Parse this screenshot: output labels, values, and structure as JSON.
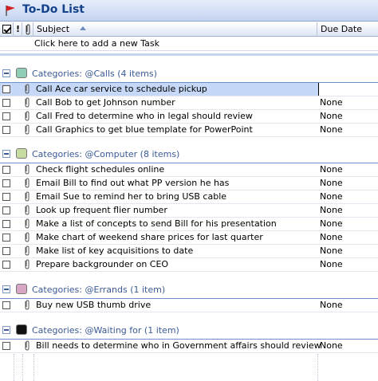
{
  "window": {
    "title": "To-Do List"
  },
  "header": {
    "important_label": "!",
    "subject_label": "Subject",
    "due_label": "Due Date"
  },
  "new_task": {
    "placeholder": "Click here to add a new Task"
  },
  "colors": {
    "calls": "#8fcfb5",
    "computer": "#c6dca0",
    "errands": "#d8a7c3",
    "waiting": "#111111"
  },
  "groups": [
    {
      "label": "Categories: @Calls (4 items)",
      "tasks": [
        {
          "subject": "Call Ace car service to schedule pickup",
          "due": ""
        },
        {
          "subject": "Call Bob to get Johnson number",
          "due": "None"
        },
        {
          "subject": "Call Fred to determine who in legal should review",
          "due": "None"
        },
        {
          "subject": "Call Graphics to get blue template for PowerPoint",
          "due": "None"
        }
      ]
    },
    {
      "label": "Categories: @Computer (8 items)",
      "tasks": [
        {
          "subject": "Check flight schedules online",
          "due": "None"
        },
        {
          "subject": "Email Bill to find out what PP version he has",
          "due": "None"
        },
        {
          "subject": "Email Sue to remind her to bring USB cable",
          "due": "None"
        },
        {
          "subject": "Look up frequent flier number",
          "due": "None"
        },
        {
          "subject": "Make a list of concepts to send Bill for his presentation",
          "due": "None"
        },
        {
          "subject": "Make chart of weekend share prices for last quarter",
          "due": "None"
        },
        {
          "subject": "Make list of key acquisitions to date",
          "due": "None"
        },
        {
          "subject": "Prepare backgrounder on CEO",
          "due": "None"
        }
      ]
    },
    {
      "label": "Categories: @Errands (1 item)",
      "tasks": [
        {
          "subject": "Buy new USB thumb drive",
          "due": "None"
        }
      ]
    },
    {
      "label": "Categories: @Waiting for (1 item)",
      "tasks": [
        {
          "subject": "Bill needs to determine who in Government affairs should review",
          "due": "None"
        }
      ]
    }
  ]
}
